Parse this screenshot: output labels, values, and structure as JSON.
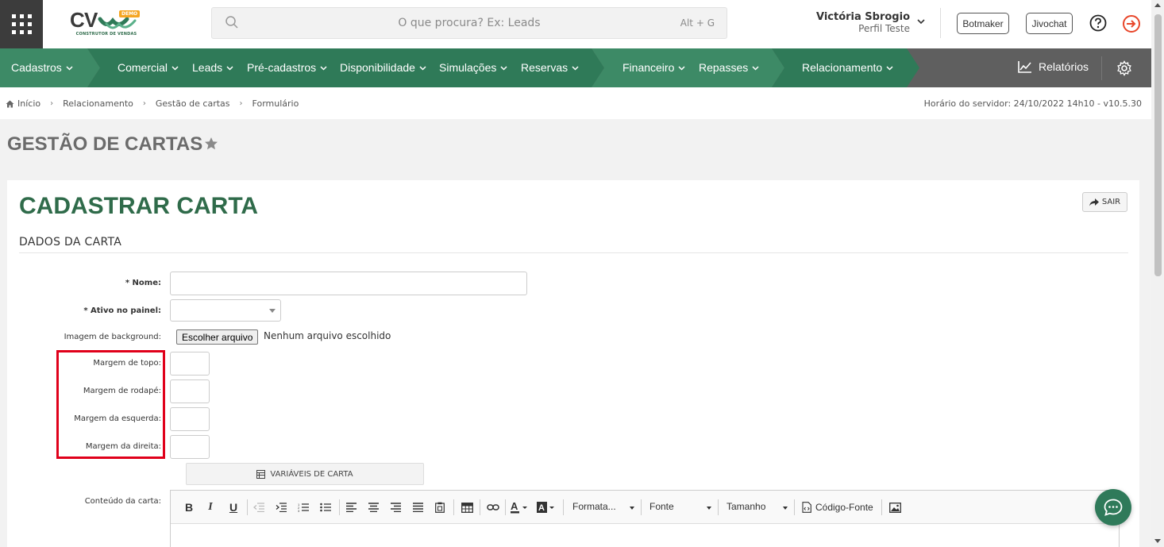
{
  "header": {
    "logo_text": "CV",
    "logo_badge": "DEMO",
    "logo_subtitle": "CONSTRUTOR DE VENDAS",
    "search_placeholder": "O que procura? Ex: Leads",
    "search_shortcut": "Alt + G",
    "user_name": "Victória Sbrogio",
    "user_profile": "Perfil Teste",
    "botmaker_label": "Botmaker",
    "jivochat_label": "Jivochat"
  },
  "nav": {
    "items": [
      {
        "label": "Cadastros"
      },
      {
        "label": "Comercial"
      },
      {
        "label": "Leads"
      },
      {
        "label": "Pré-cadastros"
      },
      {
        "label": "Disponibilidade"
      },
      {
        "label": "Simulações"
      },
      {
        "label": "Reservas"
      },
      {
        "label": "Financeiro"
      },
      {
        "label": "Repasses"
      },
      {
        "label": "Relacionamento"
      }
    ],
    "reports_label": "Relatórios",
    "colors": {
      "group1": "#3d8a66",
      "group2": "#2f7a58",
      "group3": "#3d8a66",
      "group4": "#2f7a58",
      "base": "#5f5f5f"
    }
  },
  "breadcrumb": {
    "items": [
      "Início",
      "Relacionamento",
      "Gestão de cartas",
      "Formulário"
    ],
    "server_time": "Horário do servidor: 24/10/2022 14h10 - v10.5.30"
  },
  "page": {
    "title": "GESTÃO DE CARTAS"
  },
  "form": {
    "title": "CADASTRAR CARTA",
    "exit_label": "SAIR",
    "section_title": "DADOS DA CARTA",
    "fields": {
      "name_label": "* Nome:",
      "name_value": "",
      "active_label": "* Ativo no painel:",
      "active_value": "",
      "background_label": "Imagem de background:",
      "file_button": "Escolher arquivo",
      "file_status": "Nenhum arquivo escolhido",
      "margin_top_label": "Margem de topo:",
      "margin_bottom_label": "Margem de rodapé:",
      "margin_left_label": "Margem da esquerda:",
      "margin_right_label": "Margem da direita:",
      "content_label": "Conteúdo da carta:"
    },
    "variables_button": "VARIÁVEIS DE CARTA",
    "editor": {
      "format_label": "Formata...",
      "font_label": "Fonte",
      "size_label": "Tamanho",
      "source_label": "Código-Fonte"
    },
    "accent_color": "#2f6b4a",
    "highlight_color": "#e0001a"
  }
}
